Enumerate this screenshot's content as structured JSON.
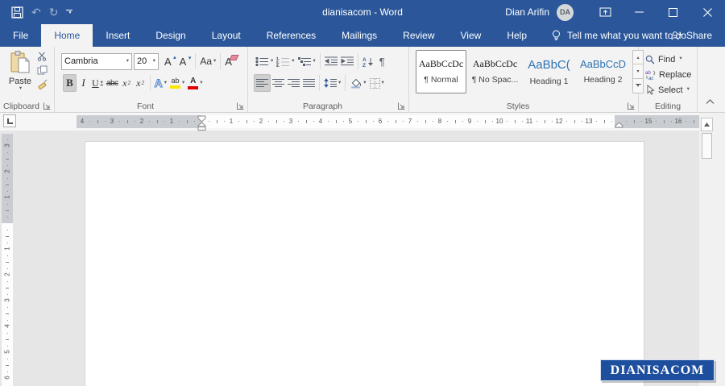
{
  "titlebar": {
    "title": "dianisacom  -  Word",
    "user": "Dian Arifin",
    "avatar_initials": "DA"
  },
  "tabs": {
    "items": [
      {
        "label": "File",
        "active": false
      },
      {
        "label": "Home",
        "active": true
      },
      {
        "label": "Insert",
        "active": false
      },
      {
        "label": "Design",
        "active": false
      },
      {
        "label": "Layout",
        "active": false
      },
      {
        "label": "References",
        "active": false
      },
      {
        "label": "Mailings",
        "active": false
      },
      {
        "label": "Review",
        "active": false
      },
      {
        "label": "View",
        "active": false
      },
      {
        "label": "Help",
        "active": false
      }
    ],
    "tell_me": "Tell me what you want to do",
    "share": "Share"
  },
  "ribbon": {
    "clipboard": {
      "label": "Clipboard",
      "paste_label": "Paste"
    },
    "font": {
      "label": "Font",
      "family": "Cambria",
      "size": "20"
    },
    "paragraph": {
      "label": "Paragraph"
    },
    "styles": {
      "label": "Styles",
      "items": [
        {
          "preview": "AaBbCcDc",
          "name": "¶ Normal",
          "selected": true,
          "color": "#1a1a1a",
          "size": 12,
          "serif": true
        },
        {
          "preview": "AaBbCcDc",
          "name": "¶ No Spac...",
          "selected": false,
          "color": "#1a1a1a",
          "size": 12,
          "serif": true
        },
        {
          "preview": "AaBbC(",
          "name": "Heading 1",
          "selected": false,
          "color": "#2e74b5",
          "size": 15,
          "serif": false
        },
        {
          "preview": "AaBbCcD",
          "name": "Heading 2",
          "selected": false,
          "color": "#2e74b5",
          "size": 13,
          "serif": false
        }
      ]
    },
    "editing": {
      "label": "Editing",
      "find": "Find",
      "replace": "Replace",
      "select": "Select"
    }
  },
  "glyphs": {
    "undo": "↶",
    "redo": "↻",
    "bold": "B",
    "italic": "I",
    "underline": "U",
    "strike": "abc",
    "sub": "x",
    "sub_s": "2",
    "sup": "x",
    "sup_s": "2",
    "grow": "A",
    "shrink": "A",
    "case": "Aa",
    "clear": "A",
    "effects": "A",
    "highlight": "ab",
    "fontcolor": "A",
    "pilcrow": "¶"
  },
  "ruler": {
    "left_numbers": [
      "4",
      "3",
      "2",
      "1"
    ],
    "main_numbers": [
      "1",
      "2",
      "3",
      "4",
      "5",
      "6",
      "7",
      "8",
      "9",
      "10",
      "11",
      "12",
      "13"
    ],
    "right_numbers": [
      "15",
      "16"
    ],
    "v_top_numbers": [
      "3",
      "2",
      "1"
    ],
    "v_bottom_numbers": [
      "1",
      "2",
      "3",
      "4",
      "5",
      "6"
    ]
  },
  "watermark": {
    "text": "DIANISACOM"
  },
  "colors": {
    "titlebar": "#2b579a",
    "accent": "#2b579a",
    "heading_blue": "#2e74b5",
    "highlight_yellow": "#ffe600",
    "font_color_red": "#e00000",
    "watermark_bg": "#1d4f9e"
  }
}
